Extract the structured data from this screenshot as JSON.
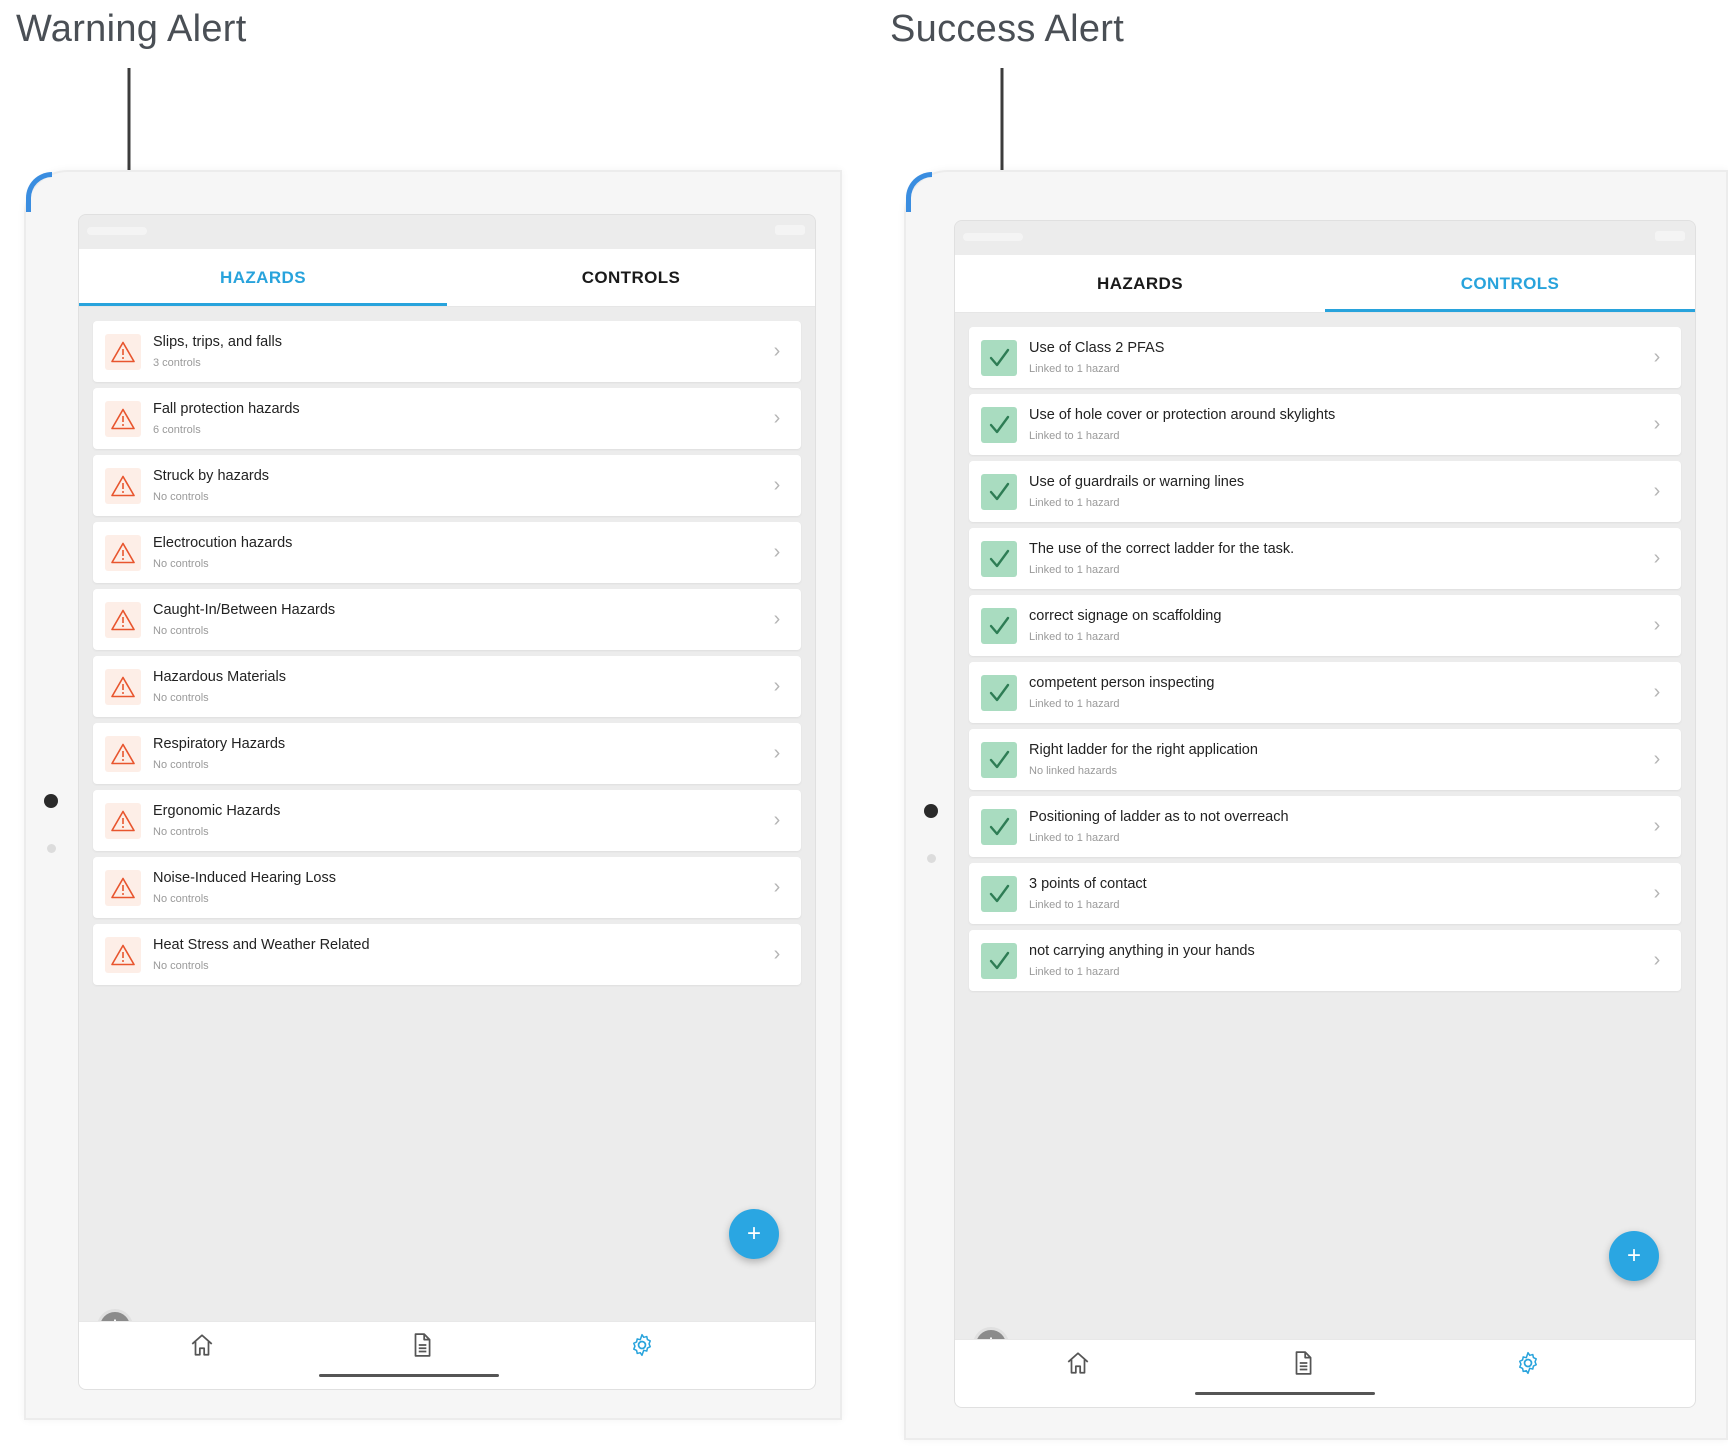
{
  "captions": {
    "left": "Warning Alert",
    "right": "Success Alert"
  },
  "colors": {
    "accent": "#28a3dc",
    "warning": "#e8552e",
    "success": "#2e7d55",
    "success_bg": "#a9dcc0"
  },
  "left_screen": {
    "tabs": [
      {
        "label": "HAZARDS",
        "active": true
      },
      {
        "label": "CONTROLS",
        "active": false
      }
    ],
    "items": [
      {
        "title": "Slips, trips, and falls",
        "subtitle": "3 controls"
      },
      {
        "title": "Fall protection hazards",
        "subtitle": "6 controls"
      },
      {
        "title": "Struck by hazards",
        "subtitle": "No controls"
      },
      {
        "title": "Electrocution hazards",
        "subtitle": "No controls"
      },
      {
        "title": "Caught-In/Between Hazards",
        "subtitle": "No controls"
      },
      {
        "title": "Hazardous Materials",
        "subtitle": "No controls"
      },
      {
        "title": "Respiratory Hazards",
        "subtitle": "No controls"
      },
      {
        "title": "Ergonomic Hazards",
        "subtitle": "No controls"
      },
      {
        "title": "Noise-Induced Hearing Loss",
        "subtitle": "No controls"
      },
      {
        "title": "Heat Stress and Weather Related",
        "subtitle": "No controls"
      }
    ],
    "item_icon": "warning-triangle-icon",
    "fab_label": "+",
    "nav_icons": [
      "home-icon",
      "document-icon",
      "gear-icon"
    ]
  },
  "right_screen": {
    "tabs": [
      {
        "label": "HAZARDS",
        "active": false
      },
      {
        "label": "CONTROLS",
        "active": true
      }
    ],
    "items": [
      {
        "title": "Use of Class 2 PFAS",
        "subtitle": "Linked to 1 hazard"
      },
      {
        "title": "Use of hole cover or protection around skylights",
        "subtitle": "Linked to 1 hazard"
      },
      {
        "title": "Use of guardrails or warning lines",
        "subtitle": "Linked to 1 hazard"
      },
      {
        "title": "The use of the correct ladder for the task.",
        "subtitle": "Linked to 1 hazard"
      },
      {
        "title": "correct signage on scaffolding",
        "subtitle": "Linked to 1 hazard"
      },
      {
        "title": "competent person inspecting",
        "subtitle": "Linked to 1 hazard"
      },
      {
        "title": "Right ladder for the right application",
        "subtitle": "No linked hazards"
      },
      {
        "title": "Positioning of ladder as to not overreach",
        "subtitle": "Linked to 1 hazard"
      },
      {
        "title": "3 points of contact",
        "subtitle": "Linked to 1 hazard"
      },
      {
        "title": "not carrying anything in your hands",
        "subtitle": "Linked to 1 hazard"
      }
    ],
    "item_icon": "checkmark-icon",
    "fab_label": "+",
    "nav_icons": [
      "home-icon",
      "document-icon",
      "gear-icon"
    ]
  }
}
